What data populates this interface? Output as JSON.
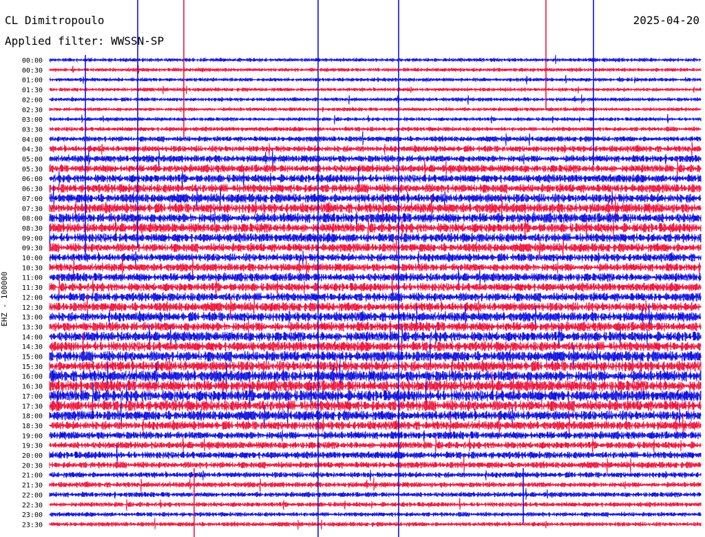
{
  "header": {
    "station": "CL Dimitropoulo",
    "filter": "Applied filter: WWSSN-SP",
    "date": "2025-04-20"
  },
  "channel_label": "EHZ - 100000",
  "colors": {
    "trace_a": "#1010e0",
    "trace_b": "#f0143c"
  },
  "chart_data": {
    "type": "line",
    "title": "",
    "ylabel": "EHZ - 100000",
    "rows": [
      "00:00",
      "00:30",
      "01:00",
      "01:30",
      "02:00",
      "02:30",
      "03:00",
      "03:30",
      "04:00",
      "04:30",
      "05:00",
      "05:30",
      "06:00",
      "06:30",
      "07:00",
      "07:30",
      "08:00",
      "08:30",
      "09:00",
      "09:30",
      "10:00",
      "10:30",
      "11:00",
      "11:30",
      "12:00",
      "12:30",
      "13:00",
      "13:30",
      "14:00",
      "14:30",
      "15:00",
      "15:30",
      "16:00",
      "16:30",
      "17:00",
      "17:30",
      "18:00",
      "18:30",
      "19:00",
      "19:30",
      "20:00",
      "20:30",
      "21:00",
      "21:30",
      "22:00",
      "22:30",
      "23:00",
      "23:30"
    ],
    "minutes_per_row": 30,
    "series_colors_alternate": [
      "blue",
      "red"
    ],
    "relative_amplitude_per_row": [
      1,
      1,
      1,
      1,
      1,
      1,
      1,
      1.2,
      1.5,
      1.8,
      2,
      2.2,
      2.3,
      2.5,
      2.6,
      2.8,
      2.8,
      2.7,
      2.6,
      2.5,
      2.3,
      2.3,
      2.4,
      2.4,
      2.5,
      2.6,
      2.7,
      2.7,
      2.8,
      2.8,
      3,
      3,
      3.2,
      3.2,
      3.2,
      3.1,
      2.8,
      2.5,
      2.2,
      2,
      2,
      1.8,
      1.6,
      1.5,
      1.4,
      1.3,
      1.2,
      1.2
    ]
  }
}
